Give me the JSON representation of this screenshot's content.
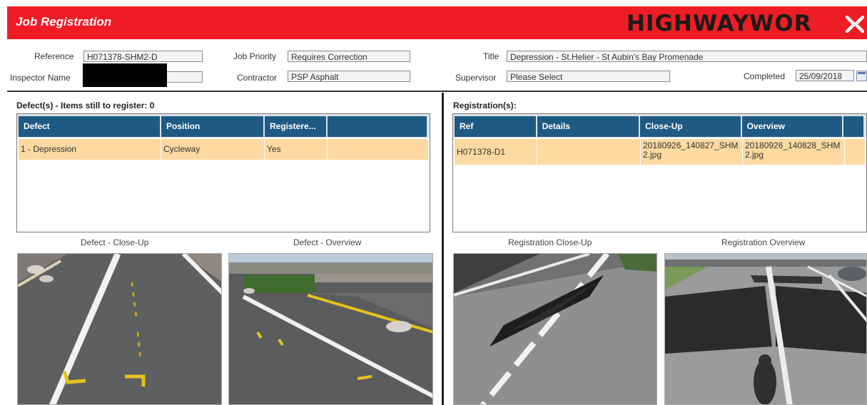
{
  "header": {
    "title": "Job Registration",
    "logo_text": "HIGHWAYWOR"
  },
  "form": {
    "reference_label": "Reference",
    "reference_value": "H071378-SHM2-D",
    "inspector_label": "Inspector Name",
    "job_priority_label": "Job Priority",
    "job_priority_value": "Requires Correction",
    "contractor_label": "Contractor",
    "contractor_value": "PSP Asphalt",
    "title_label": "Title",
    "title_value": "Depression - St.Helier - St Aubin's Bay Promenade",
    "supervisor_label": "Supervisor",
    "supervisor_value": "Please Select",
    "completed_label": "Completed",
    "completed_value": "25/09/2018"
  },
  "defects": {
    "title": "Defect(s) - Items still to register: 0",
    "columns": [
      "Defect",
      "Position",
      "Registere...",
      ""
    ],
    "rows": [
      {
        "defect": "1 - Depression",
        "position": "Cycleway",
        "registered": "Yes"
      }
    ],
    "closeup_caption": "Defect - Close-Up",
    "overview_caption": "Defect - Overview"
  },
  "registrations": {
    "title": "Registration(s):",
    "columns": [
      "Ref",
      "Details",
      "Close-Up",
      "Overview",
      ""
    ],
    "rows": [
      {
        "ref": "H071378-D1",
        "details": "",
        "closeup": "20180926_140827_SHM2.jpg",
        "overview": "20180926_140828_SHM2.jpg"
      }
    ],
    "closeup_caption": "Registration Close-Up",
    "overview_caption": "Registration Overview"
  },
  "icons": {
    "calendar": "calendar-icon",
    "logo_mark": "highwayworks-logo-mark"
  },
  "colors": {
    "header_bg": "#ee1c24",
    "grid_header": "#1f5a84",
    "row_highlight": "#fbd9a0"
  }
}
